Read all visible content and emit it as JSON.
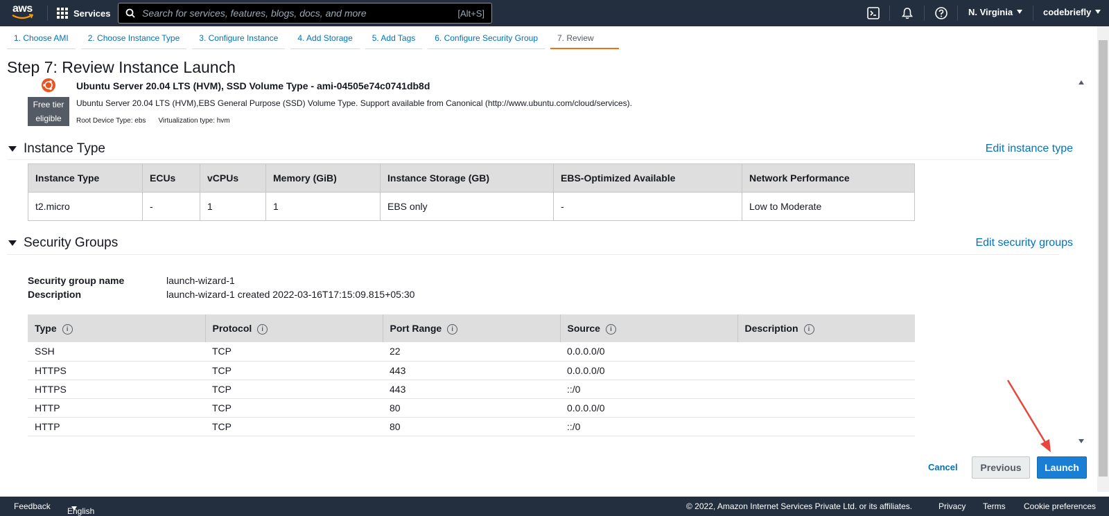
{
  "nav": {
    "logo_text": "aws",
    "services_label": "Services",
    "search_placeholder": "Search for services, features, blogs, docs, and more",
    "search_shortcut": "[Alt+S]",
    "region": "N. Virginia",
    "user": "codebriefly"
  },
  "tabs": [
    {
      "label": "1. Choose AMI"
    },
    {
      "label": "2. Choose Instance Type"
    },
    {
      "label": "3. Configure Instance"
    },
    {
      "label": "4. Add Storage"
    },
    {
      "label": "5. Add Tags"
    },
    {
      "label": "6. Configure Security Group"
    },
    {
      "label": "7. Review"
    }
  ],
  "page_title": "Step 7: Review Instance Launch",
  "ami": {
    "title": "Ubuntu Server 20.04 LTS (HVM), SSD Volume Type - ami-04505e74c0741db8d",
    "description": "Ubuntu Server 20.04 LTS (HVM),EBS General Purpose (SSD) Volume Type. Support available from Canonical (http://www.ubuntu.com/cloud/services).",
    "free_tier_line1": "Free tier",
    "free_tier_line2": "eligible",
    "root_device": "Root Device Type: ebs",
    "virtualization": "Virtualization type: hvm"
  },
  "instance_type": {
    "heading": "Instance Type",
    "edit_link": "Edit instance type",
    "columns": [
      "Instance Type",
      "ECUs",
      "vCPUs",
      "Memory (GiB)",
      "Instance Storage (GB)",
      "EBS-Optimized Available",
      "Network Performance"
    ],
    "row": [
      "t2.micro",
      "-",
      "1",
      "1",
      "EBS only",
      "-",
      "Low to Moderate"
    ]
  },
  "security_groups": {
    "heading": "Security Groups",
    "edit_link": "Edit security groups",
    "name_label": "Security group name",
    "name_value": "launch-wizard-1",
    "desc_label": "Description",
    "desc_value": "launch-wizard-1 created 2022-03-16T17:15:09.815+05:30",
    "columns": [
      "Type",
      "Protocol",
      "Port Range",
      "Source",
      "Description"
    ],
    "rows": [
      [
        "SSH",
        "TCP",
        "22",
        "0.0.0.0/0",
        ""
      ],
      [
        "HTTPS",
        "TCP",
        "443",
        "0.0.0.0/0",
        ""
      ],
      [
        "HTTPS",
        "TCP",
        "443",
        "::/0",
        ""
      ],
      [
        "HTTP",
        "TCP",
        "80",
        "0.0.0.0/0",
        ""
      ],
      [
        "HTTP",
        "TCP",
        "80",
        "::/0",
        ""
      ]
    ]
  },
  "actions": {
    "cancel": "Cancel",
    "previous": "Previous",
    "launch": "Launch"
  },
  "footer": {
    "feedback": "Feedback",
    "language": "English (US)",
    "copyright": "© 2022, Amazon Internet Services Private Ltd. or its affiliates.",
    "privacy": "Privacy",
    "terms": "Terms",
    "cookies": "Cookie preferences"
  },
  "colors": {
    "nav_bg": "#232f3e",
    "link": "#0073bb",
    "launch_button": "#1a7fd4",
    "active_tab": "#ec7211",
    "annotation_arrow": "#e8463c",
    "ubuntu": "#e95420"
  }
}
